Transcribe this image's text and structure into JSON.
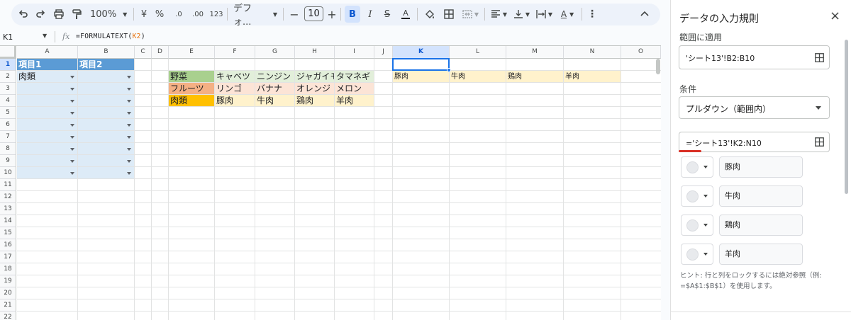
{
  "toolbar": {
    "zoom": "100%",
    "currency": "¥",
    "percent": "%",
    "dec_decrease": ".0",
    "dec_increase": ".00",
    "number_format": "123",
    "font_name": "デフォ...",
    "font_size": "10",
    "bold": "B",
    "text_color": "A"
  },
  "formula_bar": {
    "cell_ref": "K1",
    "fx": "fx",
    "formula_prefix": "=FORMULATEXT(",
    "formula_ref": "K2",
    "formula_suffix": ")"
  },
  "sheet": {
    "columns": [
      "A",
      "B",
      "C",
      "D",
      "E",
      "F",
      "G",
      "H",
      "I",
      "J",
      "K",
      "L",
      "M",
      "N",
      "O"
    ],
    "rows": [
      "1",
      "2",
      "3",
      "4",
      "5",
      "6",
      "7",
      "8",
      "9",
      "10",
      "11",
      "12",
      "13",
      "14",
      "15",
      "16",
      "17",
      "18",
      "19",
      "20",
      "21",
      "22"
    ],
    "selected_column": "K",
    "selected_row": "1",
    "header_row": {
      "a1": "項目1",
      "b1": "項目2"
    },
    "a2": "肉類",
    "table_e": {
      "rows": [
        {
          "label": "野菜",
          "items": [
            "キャベツ",
            "ニンジン",
            "ジャガイモ",
            "タマネギ"
          ]
        },
        {
          "label": "フルーツ",
          "items": [
            "リンゴ",
            "バナナ",
            "オレンジ",
            "メロン"
          ]
        },
        {
          "label": "肉類",
          "items": [
            "豚肉",
            "牛肉",
            "鶏肉",
            "羊肉"
          ]
        }
      ]
    },
    "row2_k_n": [
      "豚肉",
      "牛肉",
      "鶏肉",
      "羊肉"
    ],
    "colors": {
      "header_blue": "#5b9bd5",
      "dropdown_blue": "#ddebf7",
      "veg_green": "#a9d08e",
      "veg_light": "#e2efda",
      "fruit_orange": "#f4b084",
      "fruit_light": "#fce4d6",
      "meat_gold": "#ffc000",
      "meat_light": "#fff2cc"
    }
  },
  "panel": {
    "title": "データの入力規則",
    "close": "×",
    "range_label": "範囲に適用",
    "range_value": "'シート13'!B2:B10",
    "criteria_label": "条件",
    "criteria_value": "プルダウン（範囲内）",
    "criteria_range": "='シート13'!K2:N10",
    "options": [
      "豚肉",
      "牛肉",
      "鶏肉",
      "羊肉"
    ],
    "hint_line1": "ヒント: 行と列をロックするには絶対参照（例:",
    "hint_line2": "=$A$1:$B$1）を使用します。"
  }
}
